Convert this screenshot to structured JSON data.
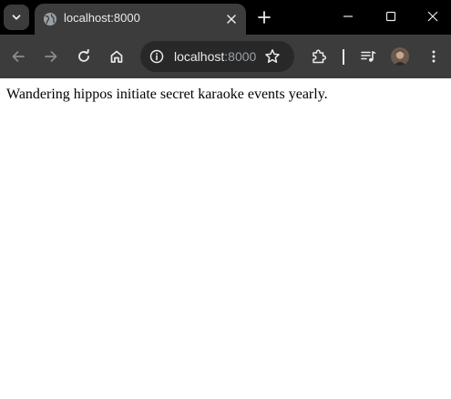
{
  "browser": {
    "tab": {
      "title": "localhost:8000",
      "favicon": "globe-icon"
    },
    "omnibox": {
      "host": "localhost",
      "port": ":8000",
      "info_icon": "info-icon",
      "bookmark_icon": "star-icon"
    },
    "toolbar_icons": [
      "back-arrow-icon",
      "forward-arrow-icon",
      "reload-icon",
      "home-icon",
      "extensions-puzzle-icon",
      "media-queue-icon",
      "avatar",
      "more-vert-icon"
    ],
    "window_controls": [
      "minimize-icon",
      "maximize-icon",
      "close-icon"
    ],
    "colors": {
      "tabstrip_bg": "#000000",
      "toolbar_bg": "#3c3c3c",
      "omnibox_bg": "#282828",
      "text_primary": "#e8eaed",
      "text_muted": "#9aa0a6"
    }
  },
  "page": {
    "body_text": "Wandering hippos initiate secret karaoke events yearly."
  }
}
